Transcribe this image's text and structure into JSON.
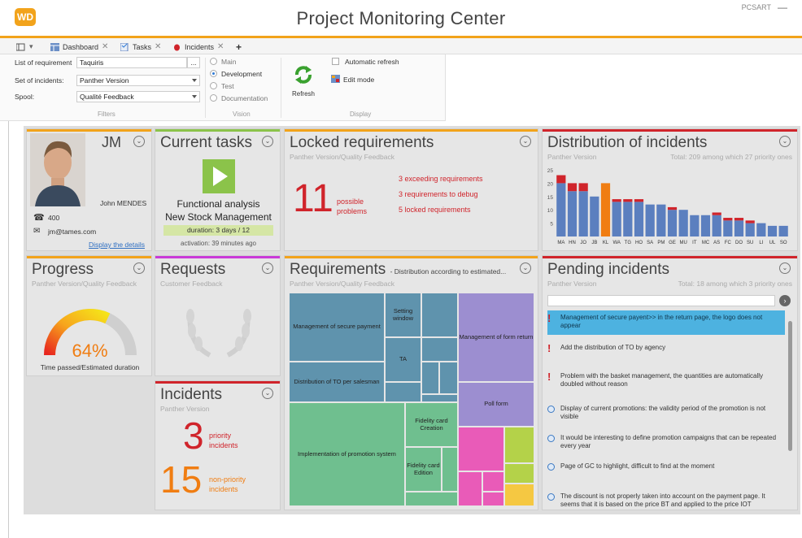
{
  "app": {
    "logo": "WD",
    "title": "Project Monitoring Center",
    "user": "PCSART",
    "minimize": "—"
  },
  "tabs": [
    {
      "label": "Dashboard",
      "close": "✕"
    },
    {
      "label": "Tasks",
      "close": "✕"
    },
    {
      "label": "Incidents",
      "close": "✕"
    }
  ],
  "tabs_add": "+",
  "filters": {
    "list_label": "List of requirement",
    "list_value": "Taquiris",
    "list_btn": "...",
    "incidents_label": "Set of incidents:",
    "incidents_value": "Panther Version",
    "spool_label": "Spool:",
    "spool_value": "Qualité Feedback",
    "section": "Filters"
  },
  "vision": {
    "options": [
      "Main",
      "Development",
      "Test",
      "Documentation"
    ],
    "selected": "Development",
    "section": "Vision"
  },
  "display": {
    "refresh_label": "Refresh",
    "auto_refresh": "Automatic refresh",
    "edit_mode": "Edit mode",
    "section": "Display"
  },
  "colors": {
    "accent": "#f2a31b",
    "red": "#d0242b",
    "orange": "#f07d12",
    "blue": "#5b7fbf",
    "green_bar": "#8bc34a",
    "magenta_bar": "#c93ad8"
  },
  "contact": {
    "initials": "JM",
    "name": "John MENDES",
    "phone": "400",
    "email": "jm@tames.com",
    "link": "Display the details"
  },
  "current_tasks": {
    "title": "Current tasks",
    "task_line1": "Functional analysis",
    "task_line2": "New Stock Management",
    "duration": "duration: 3 days / 12",
    "activation": "activation: 39 minutes ago"
  },
  "locked": {
    "title": "Locked requirements",
    "subtitle": "Panther Version/Quality Feedback",
    "count": "11",
    "count_label1": "possible",
    "count_label2": "problems",
    "items": [
      "3 exceeding requirements",
      "3 requirements to debug",
      "5 locked requirements"
    ]
  },
  "distribution": {
    "title": "Distribution of incidents",
    "subtitle": "Panther Version",
    "total": "Total: 209 among which 27 priority ones"
  },
  "progress": {
    "title": "Progress",
    "subtitle": "Panther Version/Quality Feedback",
    "percent": "64%",
    "percent_value": 64,
    "caption": "Time passed/Estimated duration"
  },
  "requests": {
    "title": "Requests",
    "subtitle": "Customer Feedback"
  },
  "requirements": {
    "title": "Requirements",
    "title_suffix": "- Distribution according to estimated...",
    "subtitle": "Panther Version/Quality Feedback",
    "labels": {
      "secure": "Management of secure payment",
      "setting": "Setting window",
      "ta": "TA",
      "distribution": "Distribution of TO per salesman",
      "formreturn": "Management of form return",
      "poll": "Poll form",
      "fidelity_creation": "Fidelity card Creation",
      "promotion": "Implementation of promotion system",
      "fidelity_edition": "Fidelity card Edition"
    }
  },
  "incidents": {
    "title": "Incidents",
    "subtitle": "Panther Version",
    "priority_count": "3",
    "priority_label1": "priority",
    "priority_label2": "incidents",
    "nonpriority_count": "15",
    "nonpriority_label1": "non-priority",
    "nonpriority_label2": "incidents"
  },
  "pending": {
    "title": "Pending incidents",
    "subtitle": "Panther Version",
    "total": "Total: 18 among which 3 priority ones",
    "items": [
      {
        "text": "Management of secure payent>> in the return page, the logo does not appear",
        "priority": true
      },
      {
        "text": "Add the distribution of TO by agency",
        "priority": true
      },
      {
        "text": "Problem with the basket management, the quantities are automatically doubled without reason",
        "priority": true
      },
      {
        "text": "Display of current promotions: the validity period of the promotion is not visible",
        "priority": false
      },
      {
        "text": "It would be interesting to define promotion campaigns that can be repeated every year",
        "priority": false
      },
      {
        "text": "Page of GC to highlight, difficult to find at the moment",
        "priority": false
      },
      {
        "text": "The discount is not properly taken into account on the payment page. It seems that it is based on the price BT and applied to the price IOT",
        "priority": false
      }
    ]
  },
  "chart_data": {
    "type": "bar",
    "title": "Distribution of incidents",
    "categories": [
      "MA",
      "HN",
      "JO",
      "JB",
      "KL",
      "WA",
      "TG",
      "HO",
      "SA",
      "PM",
      "GE",
      "MU",
      "IT",
      "MC",
      "AS",
      "FC",
      "DO",
      "SU",
      "LI",
      "UL",
      "SO"
    ],
    "series": [
      {
        "values": [
          20,
          17,
          17,
          15,
          20,
          13,
          13,
          13,
          12,
          12,
          10,
          10,
          8,
          8,
          8,
          6,
          6,
          5,
          5,
          4,
          4
        ]
      },
      {
        "values": [
          3,
          3,
          3,
          0,
          0,
          1,
          1,
          1,
          0,
          0,
          1,
          0,
          0,
          0,
          1,
          1,
          1,
          1,
          0,
          0,
          0
        ]
      }
    ],
    "colors": [
      "#5b7fbf",
      "#d0242b"
    ],
    "highlight_category": "KL",
    "highlight_color": "#f07d12",
    "ylim": [
      0,
      25
    ],
    "yticks": [
      5,
      10,
      15,
      20,
      25
    ]
  }
}
